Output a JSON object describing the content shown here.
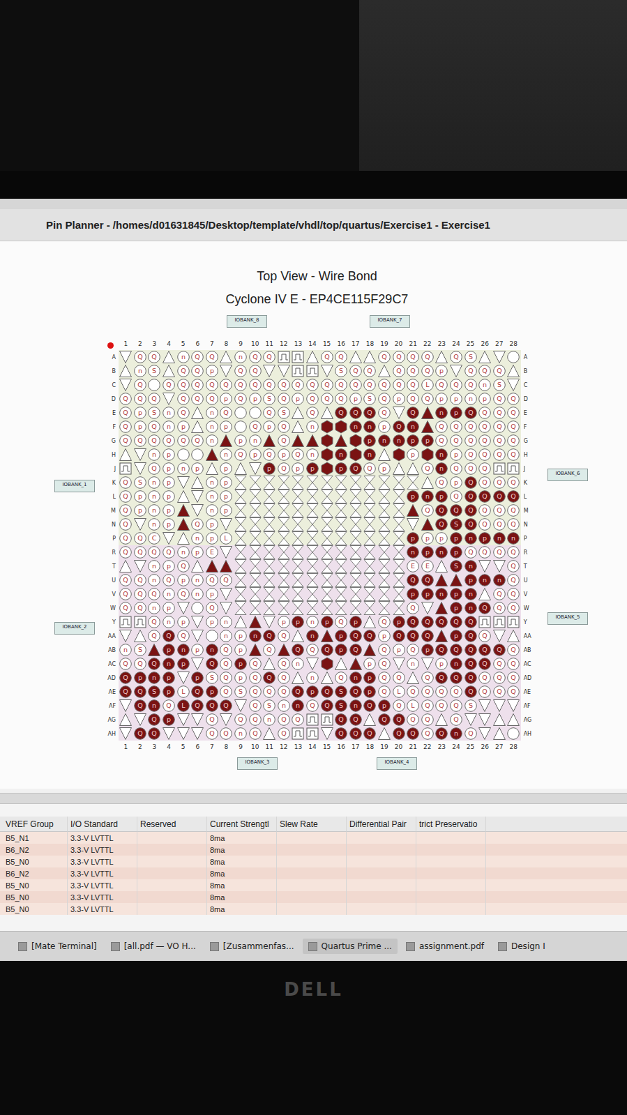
{
  "window": {
    "title": "Pin Planner - /homes/d01631845/Desktop/template/vhdl/top/quartus/Exercise1 - Exercise1"
  },
  "view": {
    "heading": "Top View - Wire Bond",
    "device": "Cyclone IV E - EP4CE115F29C7"
  },
  "pin_map": {
    "columns": [
      "1",
      "2",
      "3",
      "4",
      "5",
      "6",
      "7",
      "8",
      "9",
      "10",
      "11",
      "12",
      "13",
      "14",
      "15",
      "16",
      "17",
      "18",
      "19",
      "20",
      "21",
      "22",
      "23",
      "24",
      "25",
      "26",
      "27",
      "28"
    ],
    "rows": [
      {
        "label": "A",
        "pins": "v Q Q ^ n Q Q ^ n Q Q # # ^ Q Q ^ ^ Q Q Q Q ^ Q S ^ v o"
      },
      {
        "label": "B",
        "pins": "^ n S ^ Q Q p v Q Q v v # # v S Q Q ^ Q Q Q p v Q Q Q ^"
      },
      {
        "label": "C",
        "pins": "v Q o Q Q Q Q Q Q Q Q Q Q Q Q Q Q Q Q Q Q L Q Q Q n S v"
      },
      {
        "label": "D",
        "pins": "Q Q Q v Q Q Q p Q p S Q p Q Q Q p S Q p Q Q p p n p Q Q"
      },
      {
        "label": "E",
        "pins": "Q p S n Q ^ n Q o o Q S ^ Q ^ *Q *Q *Q Q v *Q *^ *n *p *Q Q Q Q"
      },
      {
        "label": "F",
        "pins": "Q p Q n p ^ n p o Q p Q ^ n *h *h *n *n p *Q *n *^ Q Q Q Q Q Q"
      },
      {
        "label": "G",
        "pins": "Q Q Q Q Q Q n *^ p n *^ Q *^ *^ *h *^ *h *p *n *n *p *p Q Q Q Q Q Q"
      },
      {
        "label": "H",
        "pins": "^ v n p o o *^ n Q p Q p Q n *h *n *h *n ^ *h p *h *n p Q Q Q Q"
      },
      {
        "label": "J",
        "pins": "# v Q p n p ^ p ^ v *p Q p *p *h *p *Q Q p ^ ^ Q *n Q Q Q # #"
      },
      {
        "label": "K",
        "pins": "Q S n p v ^ n p x x x x x x x x x x x x x ^ Q p *Q Q Q Q"
      },
      {
        "label": "L",
        "pins": "Q p n p ^ v n p x x x x x x x x x x x x *p *n *p Q *Q *Q *Q *Q"
      },
      {
        "label": "M",
        "pins": "Q p n p *^ v n p x x x x x x x x x x x x *^ Q *Q *Q *Q Q Q Q"
      },
      {
        "label": "N",
        "pins": "Q v n p *^ Q p v x x x x x x x x x x x x v *^ *Q *S *Q Q Q Q"
      },
      {
        "label": "P",
        "pins": "Q Q C v ^ n p L x x x x x x x x x x x x *p p p *p *n *p *n *n"
      },
      {
        "label": "R",
        "pins": "Q Q Q Q n p E v x x x x x x x x x x x x *n *p *n *p Q Q Q Q"
      },
      {
        "label": "T",
        "pins": "^ v n p Q ^ *^ *^ x x x x x x x x x x x x E E ^ *S *n v v Q"
      },
      {
        "label": "U",
        "pins": "Q Q n Q p n Q Q x x x x x x x x x x x x *Q *Q *^ *^ *p *n *n Q"
      },
      {
        "label": "V",
        "pins": "Q Q Q n Q n p v x x x x x x x x x x x x *p *p *n *p *n ^ Q Q"
      },
      {
        "label": "W",
        "pins": "Q Q n p v o Q v x x x x x x x x x x x x Q v *^ *p *n *Q Q Q"
      },
      {
        "label": "Y",
        "pins": "# # Q n p v p n ^ *^ v p *p n *p Q *p ^ Q *p *Q *Q *Q *Q *Q # # #"
      },
      {
        "label": "AA",
        "pins": "v ^ Q *Q Q v o n p *n *Q Q ^ *n *^ *p *Q *Q p *Q *Q *Q *^ *p *Q Q v ^"
      },
      {
        "label": "AB",
        "pins": "n S *^ *p *n p *n Q p *^ Q *^ *Q Q *Q *p *Q *^ Q p Q *p *Q *Q *Q *Q *Q Q"
      },
      {
        "label": "AC",
        "pins": "Q Q *Q *n *p v *Q Q *p Q ^ Q n v *h ^ *^ p Q v n v p *n *Q *Q Q Q"
      },
      {
        "label": "AD",
        "pins": "*Q *p *n *p v *p S Q p Q *Q Q ^ n ^ Q *n *p Q Q ^ Q *Q *Q *Q Q Q Q"
      },
      {
        "label": "AE",
        "pins": "*Q *Q *S *p L *Q *p Q S Q Q Q *Q *p *Q *S *Q *p Q L Q Q Q Q *Q Q Q Q"
      },
      {
        "label": "AF",
        "pins": "v *Q *n Q *L *Q *Q *Q v Q S n *n Q *Q *S *n *Q *p Q L Q Q Q S v v v"
      },
      {
        "label": "AG",
        "pins": "^ v *Q *p v v Q v Q Q n Q Q # # *Q *Q ^ *Q *Q Q Q ^ Q v v ^ ^"
      },
      {
        "label": "AH",
        "pins": "v *Q *Q v v v Q Q n Q ^ Q # # v *Q *Q *Q ^ *Q *Q Q *Q *n Q v ^ o"
      }
    ],
    "banks": [
      {
        "label": "IOBANK_8",
        "side": "top",
        "at": 0
      },
      {
        "label": "IOBANK_7",
        "side": "top",
        "at": 1
      },
      {
        "label": "IOBANK_6",
        "side": "right",
        "at": 0
      },
      {
        "label": "IOBANK_5",
        "side": "right",
        "at": 1
      },
      {
        "label": "IOBANK_1",
        "side": "left",
        "at": 0
      },
      {
        "label": "IOBANK_2",
        "side": "left",
        "at": 1
      },
      {
        "label": "IOBANK_3",
        "side": "bottom",
        "at": 0
      },
      {
        "label": "IOBANK_4",
        "side": "bottom",
        "at": 1
      }
    ]
  },
  "table": {
    "columns": [
      "VREF Group",
      "I/O Standard",
      "Reserved",
      "Current Strengtl",
      "Slew Rate",
      "Differential Pair",
      "trict Preservatio"
    ],
    "rows": [
      [
        "B5_N1",
        "3.3-V LVTTL",
        "",
        "8ma",
        "",
        "",
        ""
      ],
      [
        "B6_N2",
        "3.3-V LVTTL",
        "",
        "8ma",
        "",
        "",
        ""
      ],
      [
        "B5_N0",
        "3.3-V LVTTL",
        "",
        "8ma",
        "",
        "",
        ""
      ],
      [
        "B6_N2",
        "3.3-V LVTTL",
        "",
        "8ma",
        "",
        "",
        ""
      ],
      [
        "B5_N0",
        "3.3-V LVTTL",
        "",
        "8ma",
        "",
        "",
        ""
      ],
      [
        "B5_N0",
        "3.3-V LVTTL",
        "",
        "8ma",
        "",
        "",
        ""
      ],
      [
        "B5_N0",
        "3.3-V LVTTL",
        "",
        "8ma",
        "",
        "",
        ""
      ]
    ]
  },
  "taskbar": [
    {
      "label": "[Mate Terminal]",
      "selected": false
    },
    {
      "label": "[all.pdf — VO H...",
      "selected": false
    },
    {
      "label": "[Zusammenfas...",
      "selected": false
    },
    {
      "label": "Quartus Prime ...",
      "selected": true
    },
    {
      "label": "assignment.pdf",
      "selected": false
    },
    {
      "label": "Design I",
      "selected": false
    }
  ],
  "monitor": {
    "brand": "DELL"
  }
}
